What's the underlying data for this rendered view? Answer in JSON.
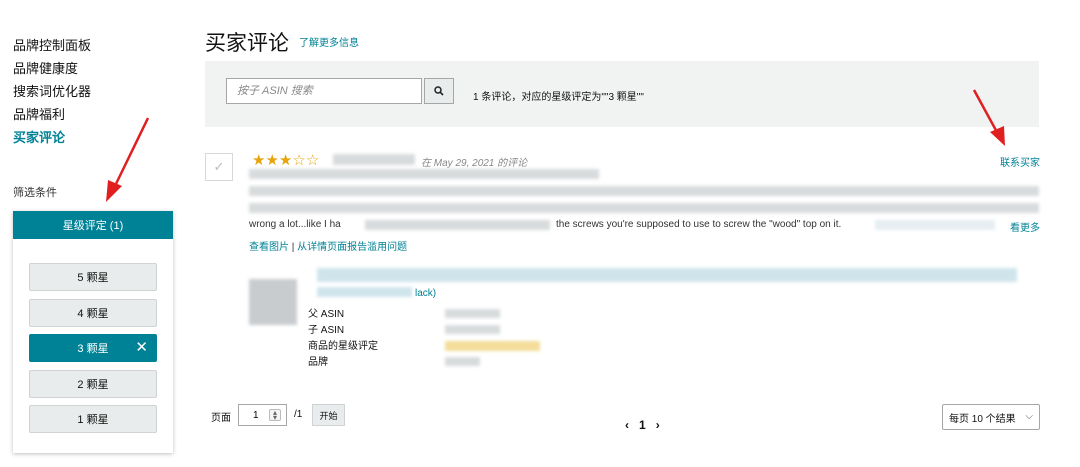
{
  "sidebar": {
    "nav": [
      {
        "label": "品牌控制面板",
        "active": false
      },
      {
        "label": "品牌健康度",
        "active": false
      },
      {
        "label": "搜索词优化器",
        "active": false
      },
      {
        "label": "品牌福利",
        "active": false
      },
      {
        "label": "买家评论",
        "active": true
      }
    ],
    "filter_title": "筛选条件",
    "filter_header": "星级评定 (1)",
    "star_options": [
      {
        "label": "5 颗星",
        "selected": false
      },
      {
        "label": "4 颗星",
        "selected": false
      },
      {
        "label": "3 颗星",
        "selected": true
      },
      {
        "label": "2 颗星",
        "selected": false
      },
      {
        "label": "1 颗星",
        "selected": false
      }
    ]
  },
  "main": {
    "title": "买家评论",
    "learn_more": "了解更多信息",
    "search": {
      "placeholder": "按子 ASIN 搜索"
    },
    "result_text": "1 条评论，对应的星级评定为\"\"3 颗星\"\"",
    "review": {
      "stars_filled": 3,
      "stars_total": 5,
      "date": "在 May 29, 2021 的评论",
      "contact_buyer": "联系买家",
      "text_visible": "wrong a lot...like I ha",
      "text_visible_2": "the screws you're supposed to use to screw the \"wood\" top on it.",
      "see_more": "看更多",
      "link_images": "查看图片",
      "link_separator": " | ",
      "link_report": "从详情页面报告滥用问题",
      "product_suffix": "lack)",
      "attributes": [
        "父 ASIN",
        "子 ASIN",
        "商品的星级评定",
        "品牌"
      ]
    },
    "pagination": {
      "label": "页面",
      "current_value": "1",
      "total": "/1",
      "go_label": "开始",
      "prev": "‹",
      "current_page": "1",
      "next": "›",
      "per_page": "每页 10 个结果"
    }
  },
  "colors": {
    "teal": "#008296",
    "star": "#e7a40b",
    "annotation_arrow": "#e02020"
  }
}
